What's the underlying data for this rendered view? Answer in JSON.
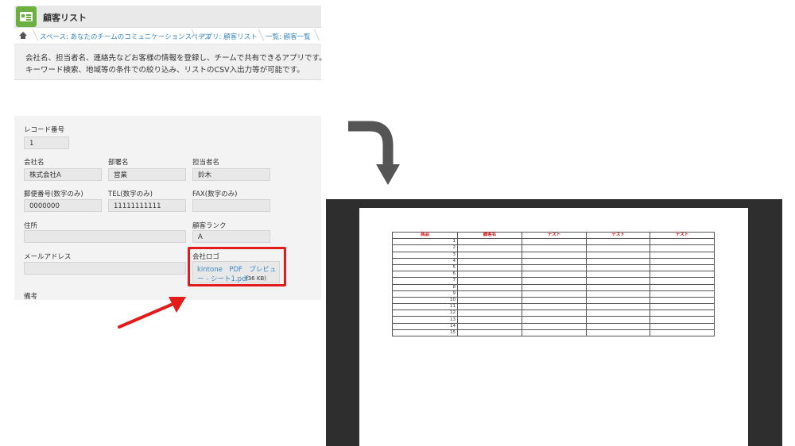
{
  "app": {
    "title": "顧客リスト"
  },
  "breadcrumb": [
    "スペース: あなたのチームのコミュニケーションスペース",
    "アプリ: 顧客リスト",
    "一覧: 顧客一覧"
  ],
  "description": [
    "会社名、担当者名、連絡先などお客様の情報を登録し、チームで共有できるアプリです。",
    "キーワード検索、地域等の条件での絞り込み、リストのCSV入出力等が可能です。"
  ],
  "record": {
    "record_number": {
      "label": "レコード番号",
      "value": "1"
    },
    "company": {
      "label": "会社名",
      "value": "株式会社A"
    },
    "department": {
      "label": "部署名",
      "value": "営業"
    },
    "person": {
      "label": "担当者名",
      "value": "鈴木"
    },
    "postal": {
      "label": "郵便番号(数字のみ)",
      "value": "0000000"
    },
    "tel": {
      "label": "TEL(数字のみ)",
      "value": "11111111111"
    },
    "fax": {
      "label": "FAX(数字のみ)",
      "value": ""
    },
    "address": {
      "label": "住所",
      "value": ""
    },
    "rank": {
      "label": "顧客ランク",
      "value": "A"
    },
    "email": {
      "label": "メールアドレス",
      "value": ""
    },
    "logo": {
      "label": "会社ロゴ",
      "file_line1": "kintone　PDF　プレビュ",
      "file_line2": "ー - シート1.pdf",
      "file_size": "(36 KB)"
    },
    "notes": {
      "label": "備考"
    }
  },
  "pdf": {
    "headers": [
      "商品",
      "顧客名",
      "テスト",
      "テスト",
      "テスト"
    ],
    "rows": [
      "1",
      "2",
      "3",
      "4",
      "5",
      "6",
      "7",
      "8",
      "9",
      "10",
      "11",
      "12",
      "13",
      "14",
      "15"
    ]
  },
  "colors": {
    "highlight": "#e21b1b",
    "arrow_gray": "#555555",
    "link": "#3a88c4",
    "app_icon": "#6bb13f"
  }
}
